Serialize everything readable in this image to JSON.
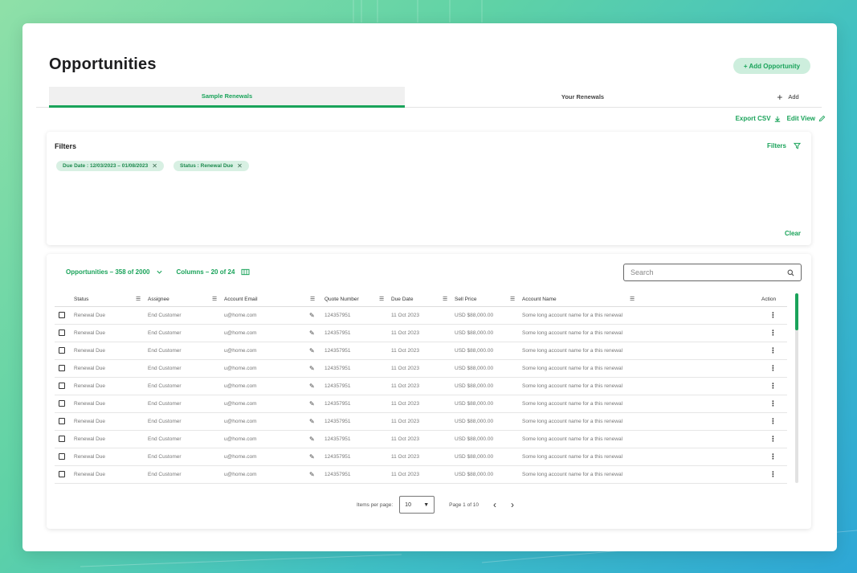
{
  "page": {
    "title": "Opportunities",
    "add_opportunity": "+ Add Opportunity"
  },
  "tabs": [
    {
      "label": "Sample Renewals",
      "active": true
    },
    {
      "label": "Your Renewals",
      "active": false
    },
    {
      "label": "Add",
      "active": false
    }
  ],
  "toolbar": {
    "export_csv": "Export CSV",
    "edit_view": "Edit View"
  },
  "filters": {
    "title": "Filters",
    "button": "Filters",
    "chips": [
      "Due Date : 12/03/2023 – 01/08/2023",
      "Status : Renewal Due"
    ],
    "clear": "Clear"
  },
  "table": {
    "opportunities_label": "Opportunities – 358 of 2000",
    "columns_label": "Columns – 20 of 24",
    "search_placeholder": "Search",
    "headers": [
      "Status",
      "Assignee",
      "Account Email",
      "Quote Number",
      "Due Date",
      "Sell Price",
      "Account Name",
      "Action"
    ],
    "rows": [
      [
        "Renewal Due",
        "End Customer",
        "u@home.com",
        "124357951",
        "11 Oct 2023",
        "USD $88,000.00",
        "Some long account name for a this renewal"
      ],
      [
        "Renewal Due",
        "End Customer",
        "u@home.com",
        "124357951",
        "11 Oct 2023",
        "USD $88,000.00",
        "Some long account name for a this renewal"
      ],
      [
        "Renewal Due",
        "End Customer",
        "u@home.com",
        "124357951",
        "11 Oct 2023",
        "USD $88,000.00",
        "Some long account name for a this renewal"
      ],
      [
        "Renewal Due",
        "End Customer",
        "u@home.com",
        "124357951",
        "11 Oct 2023",
        "USD $88,000.00",
        "Some long account name for a this renewal"
      ],
      [
        "Renewal Due",
        "End Customer",
        "u@home.com",
        "124357951",
        "11 Oct 2023",
        "USD $88,000.00",
        "Some long account name for a this renewal"
      ],
      [
        "Renewal Due",
        "End Customer",
        "u@home.com",
        "124357951",
        "11 Oct 2023",
        "USD $88,000.00",
        "Some long account name for a this renewal"
      ],
      [
        "Renewal Due",
        "End Customer",
        "u@home.com",
        "124357951",
        "11 Oct 2023",
        "USD $88,000.00",
        "Some long account name for a this renewal"
      ],
      [
        "Renewal Due",
        "End Customer",
        "u@home.com",
        "124357951",
        "11 Oct 2023",
        "USD $88,000.00",
        "Some long account name for a this renewal"
      ],
      [
        "Renewal Due",
        "End Customer",
        "u@home.com",
        "124357951",
        "11 Oct 2023",
        "USD $88,000.00",
        "Some long account name for a this renewal"
      ],
      [
        "Renewal Due",
        "End Customer",
        "u@home.com",
        "124357951",
        "11 Oct 2023",
        "USD $88,000.00",
        "Some long account name for a this renewal"
      ]
    ]
  },
  "pagination": {
    "items_per_page_label": "Items per page:",
    "items_per_page_value": "10",
    "page_label": "Page 1 of 10"
  },
  "icons": {
    "download": "download-icon",
    "edit": "pencil-icon",
    "filter": "filter-icon",
    "columns": "columns-icon",
    "search": "search-icon",
    "more": "kebab-icon"
  },
  "colors": {
    "accent": "#1aa35a",
    "chip_bg": "#d8f0e3",
    "add_button_bg": "#cdeedd"
  }
}
